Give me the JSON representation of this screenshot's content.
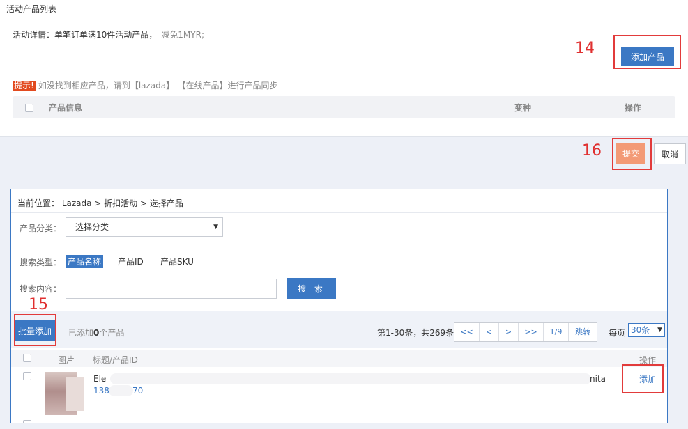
{
  "panel": {
    "title": "活动产品列表",
    "detail_label": "活动详情：",
    "detail_text": "单笔订单满10件活动产品，",
    "detail_discount": "减免1MYR;",
    "add_product_label": "添加产品",
    "tip_badge": "提示!",
    "tip_text": "如没找到相应产品，请到【lazada】-【在线产品】进行产品同步",
    "header": {
      "product_info": "产品信息",
      "variant": "变种",
      "action": "操作"
    }
  },
  "annotations": {
    "n14": "14",
    "n15": "15",
    "n16": "16"
  },
  "footer_actions": {
    "submit_label": "提交",
    "cancel_label": "取消"
  },
  "dialog": {
    "breadcrumb": "当前位置：  Lazada > 折扣活动 > 选择产品",
    "category_label": "产品分类：",
    "category_value": "选择分类",
    "search_type_label": "搜索类型：",
    "search_types": [
      "产品名称",
      "产品ID",
      "产品SKU"
    ],
    "search_content_label": "搜索内容：",
    "search_value": "",
    "search_button": "搜 索",
    "batch_add_label": "批量添加",
    "added_prefix": "已添加",
    "added_count": "0",
    "added_suffix": "个产品",
    "range_text": "第1-30条，共269条",
    "pager": [
      "<<",
      "<",
      ">",
      ">>",
      "1/9",
      "跳转"
    ],
    "per_page_label": "每页",
    "per_page_value": "30条",
    "table_headers": {
      "image": "图片",
      "title": "标题/产品ID",
      "action": "操作"
    },
    "rows": [
      {
        "title": "Ele",
        "title_tail": "nita",
        "id": "138",
        "id_tail": "70",
        "action": "添加"
      }
    ]
  }
}
